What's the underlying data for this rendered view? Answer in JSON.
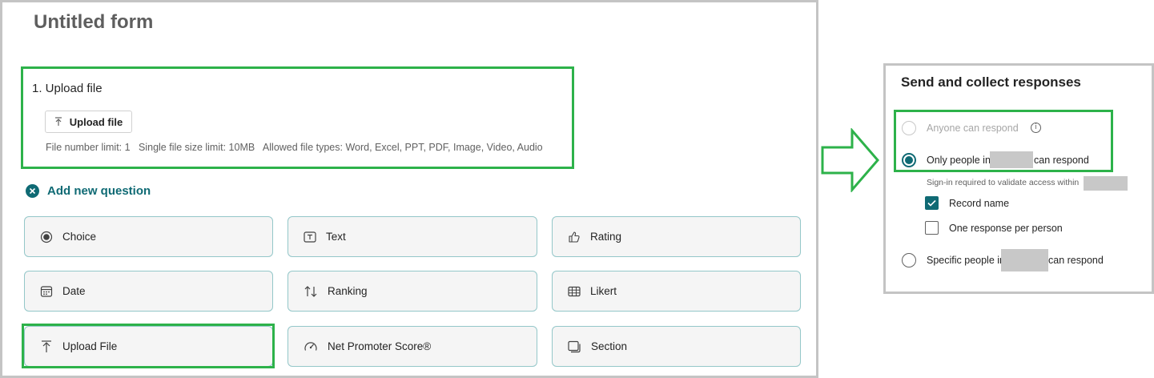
{
  "form": {
    "title": "Untitled form",
    "question": {
      "title": "1. Upload file",
      "upload_button_label": "Upload file",
      "info": "File number limit: 1   Single file size limit: 10MB   Allowed file types: Word, Excel, PPT, PDF, Image, Video, Audio"
    },
    "add_new_question_label": "Add new question",
    "question_types": [
      {
        "label": "Choice",
        "icon": "radio-icon"
      },
      {
        "label": "Text",
        "icon": "text-icon"
      },
      {
        "label": "Rating",
        "icon": "thumb-up-icon"
      },
      {
        "label": "Date",
        "icon": "calendar-icon"
      },
      {
        "label": "Ranking",
        "icon": "ranking-arrows-icon"
      },
      {
        "label": "Likert",
        "icon": "likert-grid-icon"
      },
      {
        "label": "Upload File",
        "icon": "upload-icon"
      },
      {
        "label": "Net Promoter Score®",
        "icon": "gauge-icon"
      },
      {
        "label": "Section",
        "icon": "section-icon"
      }
    ]
  },
  "send_panel": {
    "title": "Send and collect responses",
    "options": {
      "anyone": "Anyone can respond",
      "only_people_prefix": "Only people in",
      "only_people_suffix": "can respond",
      "signin_note": "Sign-in required to validate access within",
      "record_name": "Record name",
      "one_response": "One response per person",
      "specific_prefix": "Specific people in",
      "specific_suffix": "can respond"
    },
    "state": {
      "selected_option": "only_people",
      "anyone_disabled": true,
      "record_name_checked": true,
      "one_response_checked": false
    }
  },
  "colors": {
    "accent": "#0f6a74",
    "highlight": "#2db24a",
    "tile_border": "#94c7c9",
    "tile_bg": "#f5f5f5",
    "redaction": "#c8c8c8"
  }
}
